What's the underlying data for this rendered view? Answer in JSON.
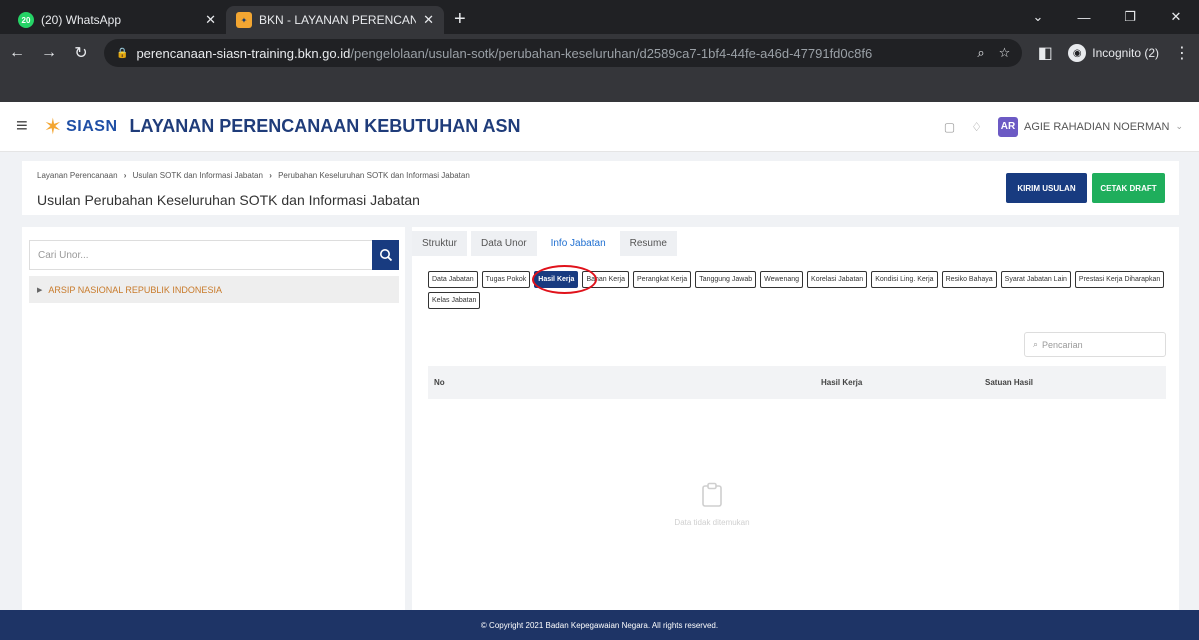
{
  "browser": {
    "tabs": [
      {
        "title": "(20) WhatsApp",
        "favicon": "whatsapp-icon",
        "badge": "20"
      },
      {
        "title": "BKN - LAYANAN PERENCANAAN",
        "favicon": "bkn-icon"
      }
    ],
    "url_host": "perencanaan-siasn-training.bkn.go.id",
    "url_path": "/pengelolaan/usulan-sotk/perubahan-keseluruhan/d2589ca7-1bf4-44fe-a46d-47791fd0c8f6",
    "incognito_label": "Incognito (2)"
  },
  "app": {
    "logo_text": "SIASN",
    "title": "LAYANAN PERENCANAAN KEBUTUHAN ASN",
    "user_initials": "AR",
    "user_name": "AGIE RAHADIAN NOERMAN"
  },
  "page": {
    "breadcrumb": [
      "Layanan Perencanaan",
      "Usulan SOTK dan Informasi Jabatan",
      "Perubahan Keseluruhan SOTK dan Informasi Jabatan"
    ],
    "title": "Usulan Perubahan Keseluruhan SOTK dan Informasi Jabatan",
    "kirim_label": "KIRIM USULAN",
    "cetak_label": "CETAK DRAFT"
  },
  "left": {
    "search_placeholder": "Cari Unor...",
    "tree_item": "ARSIP NASIONAL REPUBLIK INDONESIA"
  },
  "right": {
    "tabs": [
      "Struktur",
      "Data Unor",
      "Info Jabatan",
      "Resume"
    ],
    "active_tab": 2,
    "chips": [
      "Data Jabatan",
      "Tugas Pokok",
      "Hasil Kerja",
      "Bahan Kerja",
      "Perangkat Kerja",
      "Tanggung Jawab",
      "Wewenang",
      "Korelasi Jabatan",
      "Kondisi Ling. Kerja",
      "Resiko Bahaya",
      "Syarat Jabatan Lain",
      "Prestasi Kerja Diharapkan",
      "Kelas Jabatan"
    ],
    "active_chip": 2,
    "search_placeholder": "Pencarian",
    "columns": {
      "no": "No",
      "hasil": "Hasil Kerja",
      "satuan": "Satuan Hasil"
    },
    "empty_text": "Data tidak ditemukan"
  },
  "footer": "© Copyright 2021 Badan Kepegawaian Negara. All rights reserved.",
  "colors": {
    "primary": "#183b80",
    "success": "#1fae5c",
    "highlight": "#e0121b",
    "footer": "#1e3466"
  }
}
